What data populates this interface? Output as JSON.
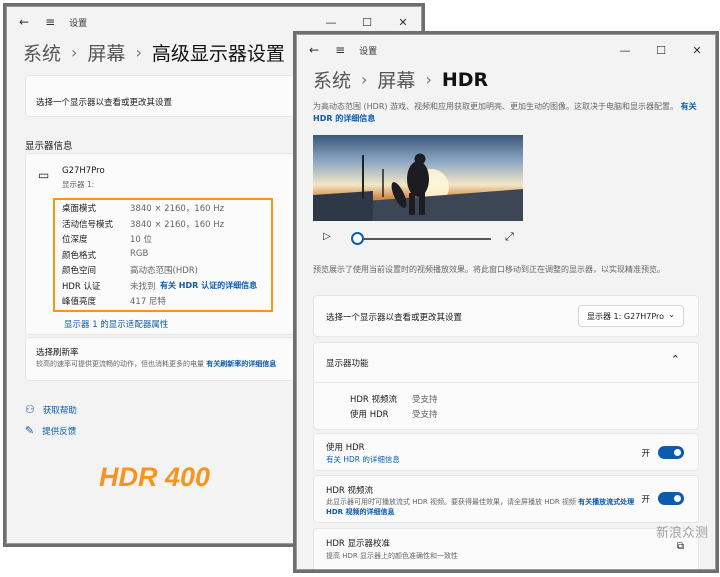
{
  "left": {
    "title": "设置",
    "breadcrumb": [
      "系统",
      "屏幕",
      "高级显示器设置"
    ],
    "select_display": "选择一个显示器以查看或更改其设置",
    "display_info_heading": "显示器信息",
    "monitor_name": "G27H7Pro",
    "monitor_sub": "显示器 1:",
    "info_rows": [
      {
        "k": "桌面模式",
        "v": "3840 × 2160，160 Hz"
      },
      {
        "k": "活动信号模式",
        "v": "3840 × 2160，160 Hz"
      },
      {
        "k": "位深度",
        "v": "10 位"
      },
      {
        "k": "颜色格式",
        "v": "RGB"
      },
      {
        "k": "颜色空间",
        "v": "高动态范围(HDR)"
      },
      {
        "k": "HDR 认证",
        "v": "未找到",
        "link": "有关 HDR 认证的详细信息"
      },
      {
        "k": "峰值亮度",
        "v": "417 尼特"
      }
    ],
    "adapter_link": "显示器 1 的显示适配器属性",
    "refresh_title": "选择刷新率",
    "refresh_desc": "较高的速率可提供更流畅的动作，但也消耗更多的电量",
    "refresh_link": "有关刷新率的详细信息",
    "help": "获取帮助",
    "feedback": "提供反馈",
    "hdr_label": "HDR 400",
    "hdr_label_color": "#f7941d",
    "highlight_color": "#f7941d"
  },
  "right": {
    "title": "设置",
    "breadcrumb": [
      "系统",
      "屏幕",
      "HDR"
    ],
    "intro": "为高动态范围 (HDR) 游戏、视频和应用获取更加明亮、更加生动的图像。这取决于电脑和显示器配置。",
    "intro_link": "有关 HDR 的详细信息",
    "preview_note": "预览展示了使用当前设置时的视频播放效果。将此窗口移动到正在调整的显示器，以实现精准预览。",
    "select_display": "选择一个显示器以查看或更改其设置",
    "display_dropdown": "显示器 1: G27H7Pro",
    "capabilities_title": "显示器功能",
    "capabilities": [
      {
        "k": "HDR 视频流",
        "v": "受支持"
      },
      {
        "k": "使用 HDR",
        "v": "受支持"
      }
    ],
    "use_hdr": "使用 HDR",
    "use_hdr_link": "有关 HDR 的详细信息",
    "use_hdr_state": "开",
    "hdr_stream": "HDR 视频流",
    "hdr_stream_desc": "此显示器可用时可播放流式 HDR 视频。要获得最佳效果，请全屏播放 HDR 视频",
    "hdr_stream_link": "有关播放流式处理 HDR 视频的详细信息",
    "hdr_stream_state": "开",
    "calib_title": "HDR 显示器校准",
    "calib_desc": "提高 HDR 显示器上的颜色准确性和一致性"
  },
  "watermark": "新浪众测"
}
